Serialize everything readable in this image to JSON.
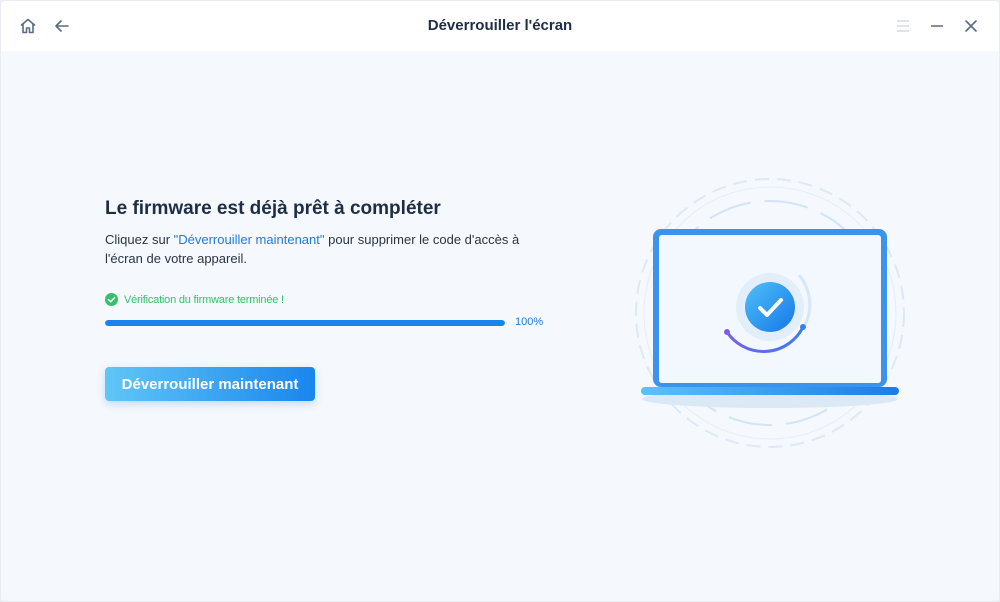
{
  "window": {
    "title": "Déverrouiller l'écran",
    "icons": {
      "home": "home-icon",
      "back": "arrow-left-icon",
      "menu": "menu-icon",
      "minimize": "minimize-icon",
      "close": "close-icon"
    }
  },
  "main": {
    "heading": "Le firmware est déjà prêt à compléter",
    "description_prefix": "Cliquez sur ",
    "description_link": "\"Déverrouiller maintenant\"",
    "description_suffix": " pour supprimer le code d'accès à l'écran de votre appareil.",
    "status_text": "Vérification du firmware terminée !",
    "progress_value": 1.0,
    "progress_label": "100%",
    "unlock_button": "Déverrouiller maintenant"
  },
  "colors": {
    "accent": "#1a84ea",
    "success": "#33c26b",
    "title_text": "#1f2d45",
    "background": "#f5f8fc"
  },
  "illustration": {
    "icon": "laptop-check-icon"
  }
}
